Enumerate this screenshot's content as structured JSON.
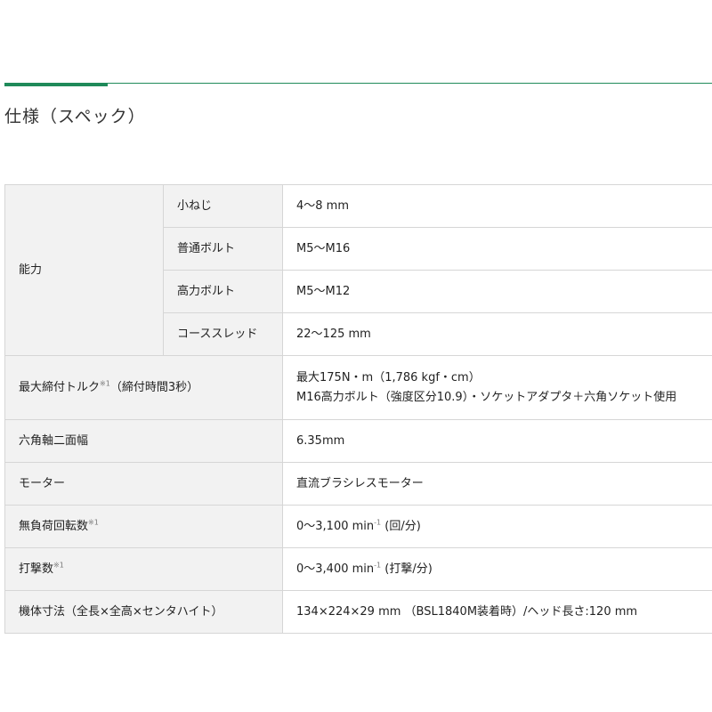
{
  "header": {
    "title": "仕様（スペック）",
    "accent_color": "#1f8a5a"
  },
  "spec": {
    "capacity": {
      "label": "能力",
      "rows": [
        {
          "label": "小ねじ",
          "value": "4〜8 mm"
        },
        {
          "label": "普通ボルト",
          "value": "M5〜M16"
        },
        {
          "label": "高力ボルト",
          "value": "M5〜M12"
        },
        {
          "label": "コーススレッド",
          "value": "22〜125 mm"
        }
      ]
    },
    "torque": {
      "label": "最大締付トルク",
      "note": "※1",
      "label_suffix": "（締付時間3秒）",
      "value_line1": "最大175N・m（1,786 kgf・cm）",
      "value_line2": "M16高力ボルト（強度区分10.9）・ソケットアダプタ＋六角ソケット使用"
    },
    "hex": {
      "label": "六角軸二面幅",
      "value": "6.35mm"
    },
    "motor": {
      "label": "モーター",
      "value": "直流ブラシレスモーター"
    },
    "noload": {
      "label": "無負荷回転数",
      "note": "※1",
      "value_pre": "0〜3,100 min",
      "value_sup": "-1",
      "value_post": " (回/分)"
    },
    "impact": {
      "label": "打撃数",
      "note": "※1",
      "value_pre": "0〜3,400 min",
      "value_sup": "-1",
      "value_post": " (打撃/分)"
    },
    "dimensions": {
      "label": "機体寸法（全長×全高×センタハイト）",
      "value": "134×224×29 mm （BSL1840M装着時）/ヘッド長さ:120 mm"
    }
  }
}
